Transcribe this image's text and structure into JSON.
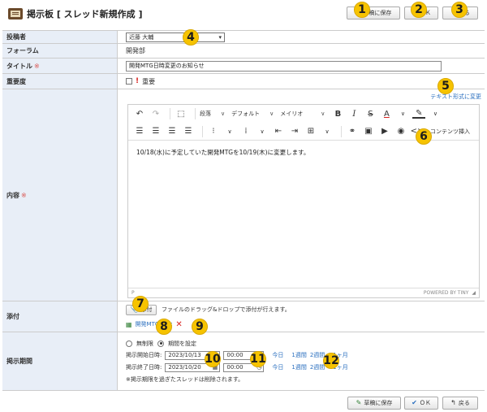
{
  "header": {
    "title": "掲示板 [ スレッド新規作成 ]",
    "save_label": "草稿に保存",
    "ok_label": "ＯＫ",
    "back_label": "戻る"
  },
  "form": {
    "poster": {
      "label": "投稿者",
      "value": "近藤 大輔"
    },
    "forum": {
      "label": "フォーラム",
      "value": "開発部"
    },
    "title": {
      "label": "タイトル",
      "required_mark": "※",
      "value": "開発MTG日時変更のお知らせ"
    },
    "importance": {
      "label": "重要度",
      "option": "重要"
    },
    "content": {
      "label": "内容",
      "required_mark": "※",
      "format_link": "テキスト形式に変更",
      "toolbar": {
        "paragraph": "段落",
        "default": "デフォルト",
        "font": "メイリオ",
        "content_insert": "コンテンツ挿入"
      },
      "body": "10/18(水)に予定していた開発MTGを10/19(木)に変更します。",
      "status_left": "P",
      "powered_by": "POWERED BY TINY"
    },
    "attach": {
      "label": "添付",
      "button": "添付",
      "hint": "ファイルのドラッグ&ドロップで添付が行えます。",
      "file_name": "開発MTG.xlsx"
    },
    "period": {
      "label": "掲示期間",
      "unlimited": "無制限",
      "set": "期間を設定",
      "start_label": "掲示開始日時:",
      "start_date": "2023/10/13",
      "start_time": "00:00",
      "end_label": "掲示終了日時:",
      "end_date": "2023/10/20",
      "end_time": "00:00",
      "quick": [
        "今日",
        "1週間",
        "2週間",
        "1ヶ月"
      ],
      "note": "※掲示期限を過ぎたスレッドは削除されます。"
    }
  },
  "footer": {
    "save_label": "草稿に保存",
    "ok_label": "ＯＫ",
    "back_label": "戻る"
  },
  "markers": [
    "1",
    "2",
    "3",
    "4",
    "5",
    "6",
    "7",
    "8",
    "9",
    "10",
    "11",
    "12"
  ]
}
